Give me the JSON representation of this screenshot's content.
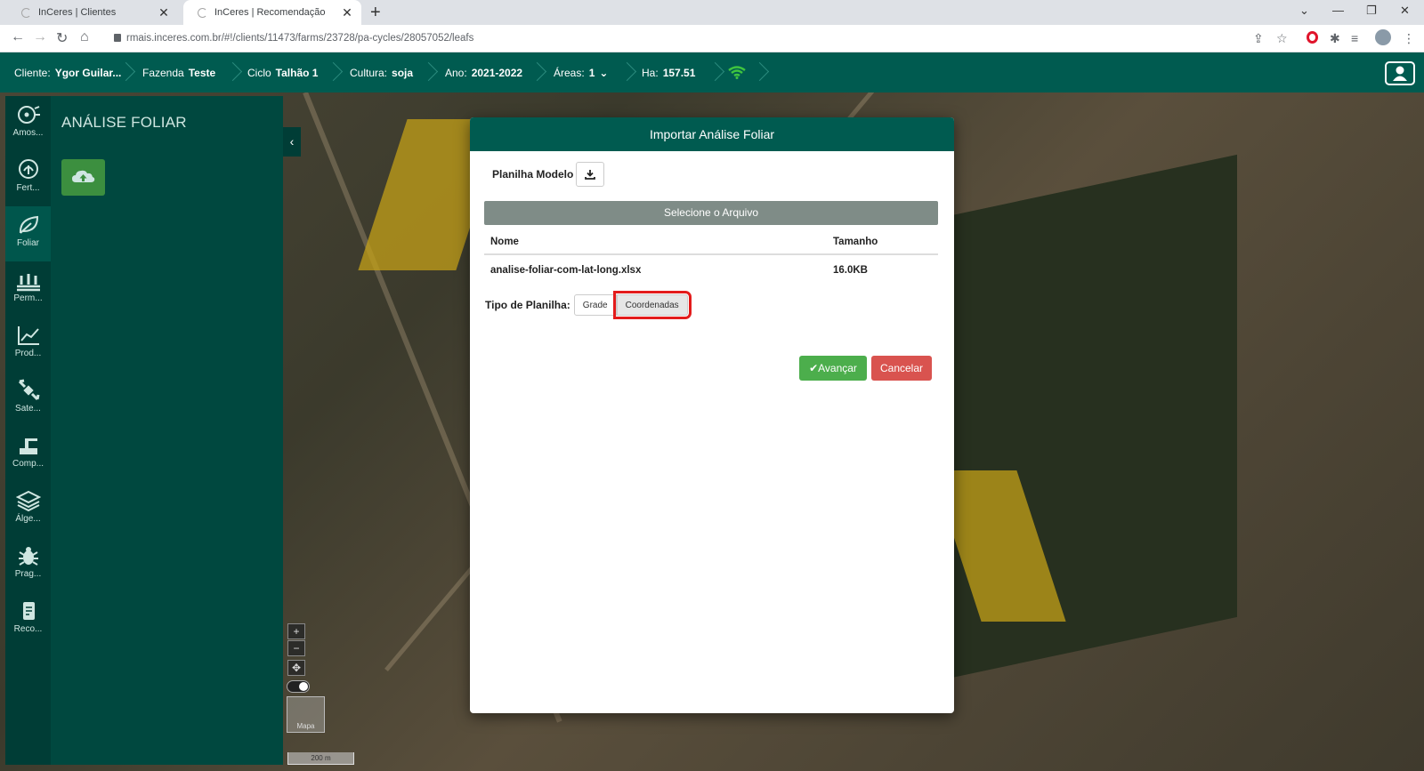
{
  "browser": {
    "tabs": [
      {
        "title": "InCeres | Clientes",
        "close": "✕"
      },
      {
        "title": "InCeres | Recomendação",
        "close": "✕"
      }
    ],
    "new_tab": "+",
    "url": "rmais.inceres.com.br/#!/clients/11473/farms/23728/pa-cycles/28057052/leafs",
    "window_controls": {
      "minimize": "—",
      "restore": "❐",
      "close": "✕"
    }
  },
  "header": {
    "crumbs": [
      {
        "label": "Cliente:",
        "value": "Ygor Guilar..."
      },
      {
        "label": "Fazenda",
        "value": "Teste"
      },
      {
        "label": "Ciclo",
        "value": "Talhão 1"
      },
      {
        "label": "Cultura:",
        "value": "soja"
      },
      {
        "label": "Ano:",
        "value": "2021-2022"
      },
      {
        "label": "Áreas:",
        "value": "1"
      },
      {
        "label": "Ha:",
        "value": "157.51"
      }
    ],
    "wifi_color": "#3fc43f"
  },
  "sidebar": {
    "items": [
      {
        "label": "Amos...",
        "icon": "sampling-icon"
      },
      {
        "label": "Fert...",
        "icon": "fertility-icon"
      },
      {
        "label": "Foliar",
        "icon": "leaf-icon",
        "active": true
      },
      {
        "label": "Perm...",
        "icon": "permanent-crop-icon"
      },
      {
        "label": "Prod...",
        "icon": "productivity-chart-icon"
      },
      {
        "label": "Sate...",
        "icon": "satellite-icon"
      },
      {
        "label": "Comp...",
        "icon": "compaction-icon"
      },
      {
        "label": "Álge...",
        "icon": "layers-icon"
      },
      {
        "label": "Prag...",
        "icon": "bug-icon"
      },
      {
        "label": "Reco...",
        "icon": "recommendation-icon"
      }
    ]
  },
  "panel": {
    "title": "ANÁLISE FOLIAR"
  },
  "map": {
    "zoom_in": "+",
    "zoom_out": "−",
    "pan": "✥",
    "minimap_label": "Mapa",
    "scale": "200 m"
  },
  "modal": {
    "title": "Importar Análise Foliar",
    "model_label": "Planilha Modelo",
    "select_file": "Selecione o Arquivo",
    "table": {
      "columns": [
        "Nome",
        "Tamanho"
      ],
      "rows": [
        [
          "analise-foliar-com-lat-long.xlsx",
          "16.0KB"
        ]
      ]
    },
    "tipo_label": "Tipo de Planilha:",
    "tipo_options": [
      "Grade",
      "Coordenadas"
    ],
    "tipo_selected": "Coordenadas",
    "advance": "✔Avançar",
    "cancel": "Cancelar"
  },
  "colors": {
    "primary": "#005b50",
    "success": "#4cae4c",
    "danger": "#d9534f",
    "highlight": "#e31b1b"
  }
}
